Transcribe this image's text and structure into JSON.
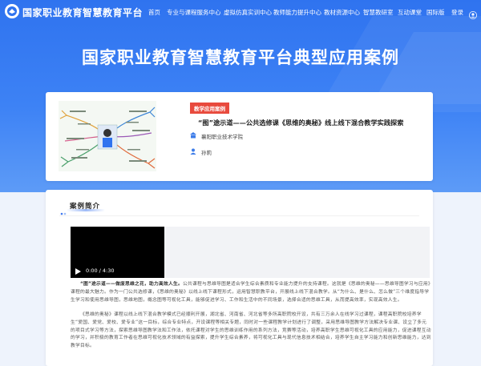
{
  "header": {
    "site_title": "国家职业教育智慧教育平台",
    "nav": [
      "首页",
      "专业与课程服务中心",
      "虚拟仿真实训中心",
      "教师能力提升中心",
      "教材资源中心",
      "智慧教研室",
      "互动课堂",
      "国际版"
    ],
    "login_label": "登录"
  },
  "page_heading": "国家职业教育智慧教育平台典型应用案例",
  "case_card": {
    "badge": "教学应用案例",
    "title": "“图”途示道——公共选修课《思维的奥秘》线上线下混合教学实践探索",
    "school": "襄阳职业技术学院",
    "author": "孙莉"
  },
  "intro": {
    "section_title": "案例简介",
    "video_time": "0:00 / 4:30",
    "para1_lead": "“图”途示道——做废思维之花，助力高效人生。",
    "para1_rest": "公共课程与思维导图是适合学生综合素质和专业能力提升的支持课程。这就是《思维的奥秘——思维导图学习与应用》课程的最大魅力。作为一门公共选修课，《思维的奥秘》以线上线下课程形式，运用智慧职教平台，开展线上线下混合教学。从“为什么、是什么、怎么做”三个维度指导学生学习和使用思维导图，思维地图，概念图等可视化工具，能够促进学习、工作和生活中的不同场景，选择合适的思维工具，从而提高效率，实现高效人生。",
    "para2": "《思维的奥秘》课程以线上线下混合教学模式已经顺利开展，湖北省、河南省、河北省等多所高职院校开设，共有三万余人在线学习过课程，课程高职院校培养学生“爱国、爱党、爱校、爱专业”这一目标，综合专业特点，开设课程等相关专题，同时对一些课程教学计划进行了调整，采用思维导图教学方法解决专业课、设立了多元的项目式学习等方法，探索思维导图教学法和工作法，依托课程对学生的思维训练作用的系列方法，竞赛等活动，培养高职学生思维可视化工具的应用能力，促进课程互动的学习，并积极的教育工作者在思维可视化技术领域的有益探索，提升学生综合素养，将可视化工具与现代信息技术相结合，培养学生自主学习能力和创新思维能力，达到教学目标。"
  },
  "colors": {
    "hero_blue": "#2f73ef",
    "badge_red": "#e84a3d",
    "page_bg": "#eef3fc"
  }
}
